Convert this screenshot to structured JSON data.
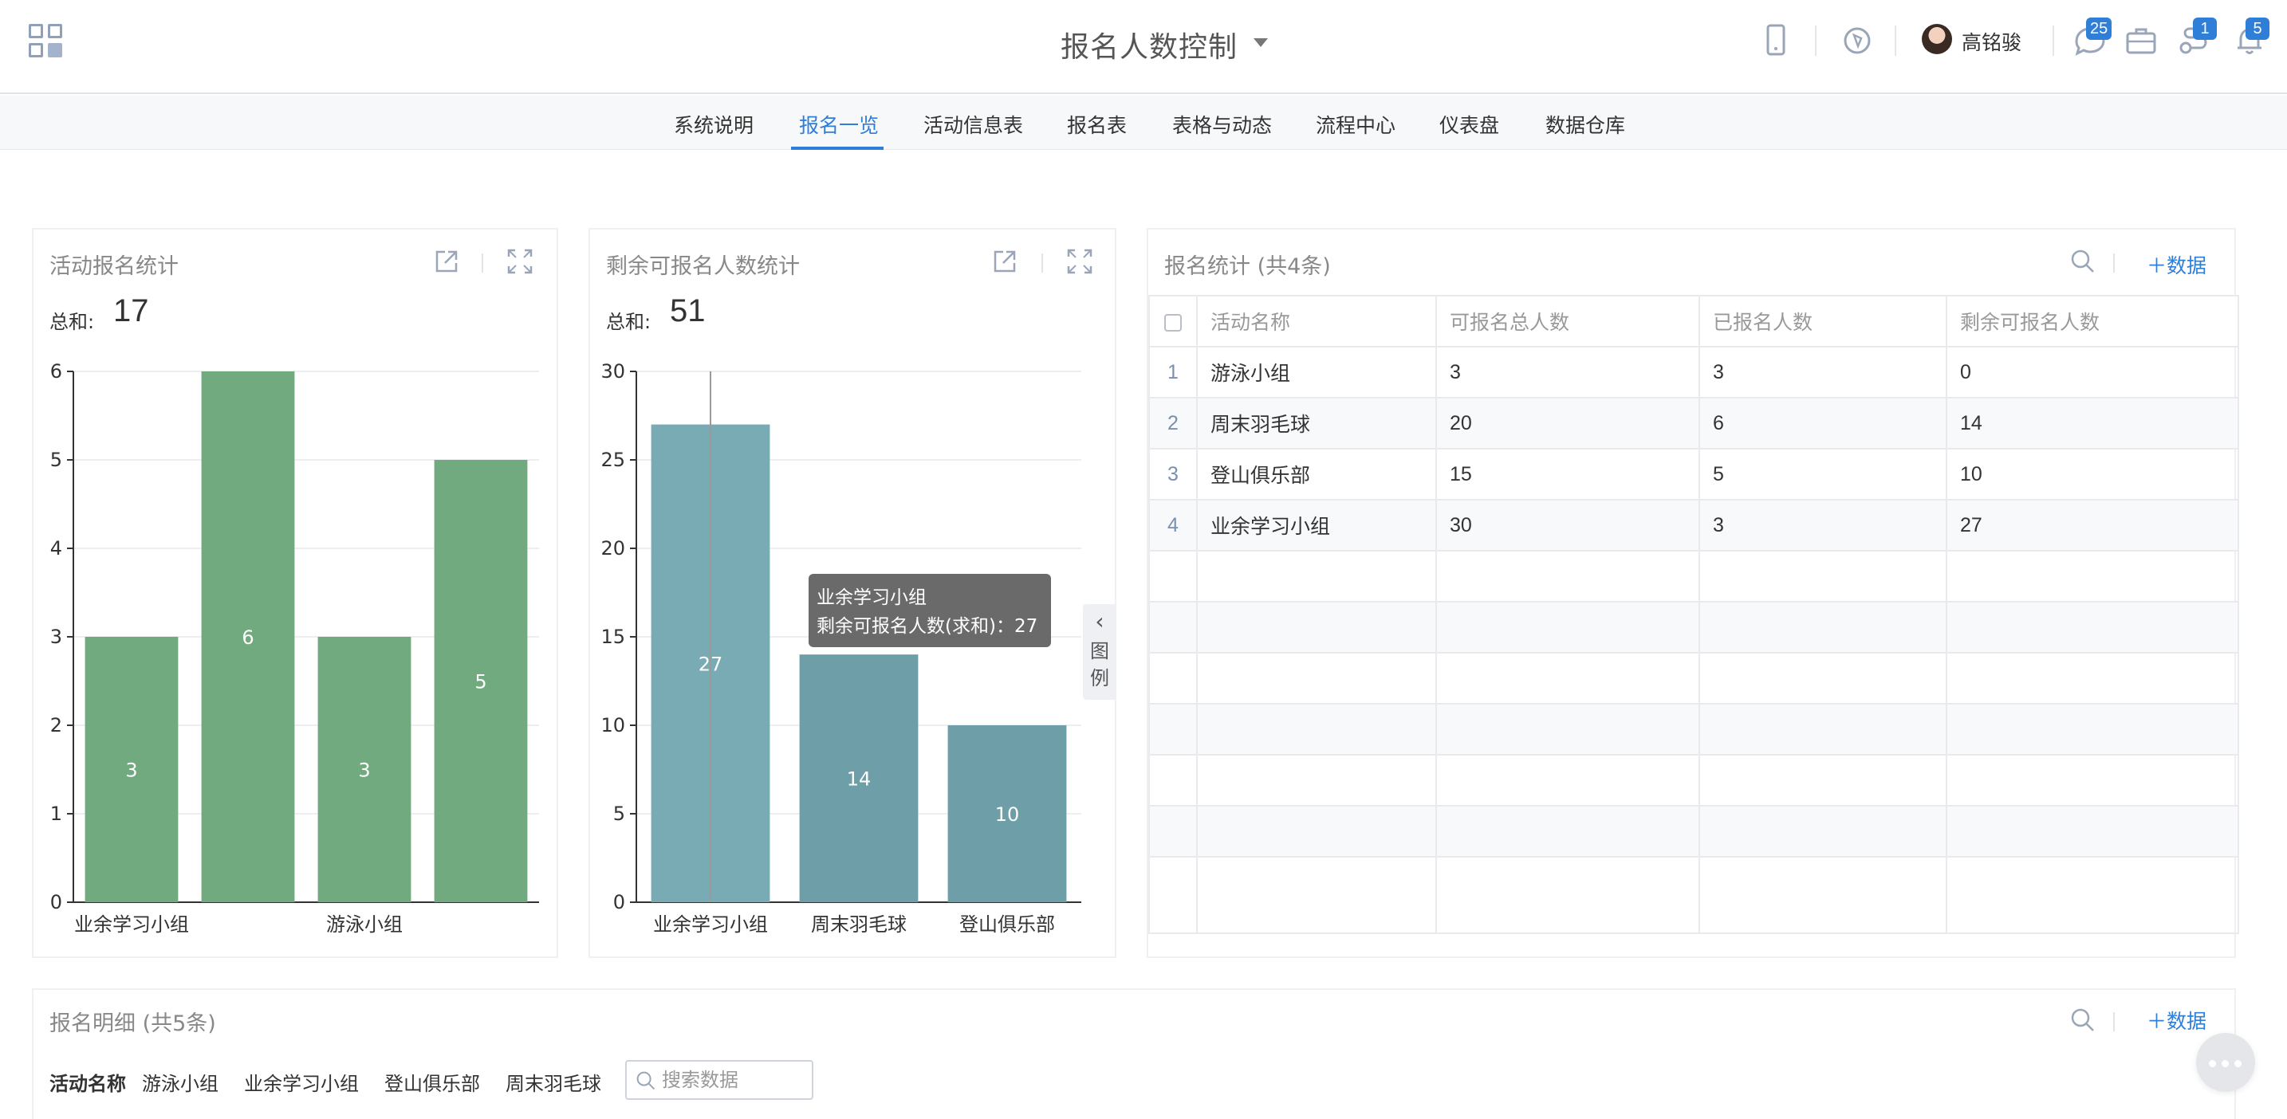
{
  "header": {
    "title": "报名人数控制",
    "user_name": "高铭骏",
    "badges": {
      "chat": "25",
      "tasks": "1",
      "notifications": "5"
    }
  },
  "nav": {
    "tabs": [
      "系统说明",
      "报名一览",
      "活动信息表",
      "报名表",
      "表格与动态",
      "流程中心",
      "仪表盘",
      "数据仓库"
    ],
    "active_index": 1
  },
  "card1": {
    "title": "活动报名统计",
    "sum_label": "总和:",
    "sum_value": "17"
  },
  "card2": {
    "title": "剩余可报名人数统计",
    "sum_label": "总和:",
    "sum_value": "51"
  },
  "chart_data": [
    {
      "type": "bar",
      "categories": [
        "业余学习小组",
        "",
        "游泳小组",
        ""
      ],
      "values": [
        3,
        6,
        3,
        5
      ],
      "ylim": [
        0,
        6
      ],
      "yticks": [
        0,
        1,
        2,
        3,
        4,
        5,
        6
      ],
      "color": "#72aa80",
      "grid": true
    },
    {
      "type": "bar",
      "categories": [
        "业余学习小组",
        "周末羽毛球",
        "登山俱乐部"
      ],
      "values": [
        27,
        14,
        10
      ],
      "ylim": [
        0,
        30
      ],
      "yticks": [
        0,
        5,
        10,
        15,
        20,
        25,
        30
      ],
      "color": "#6e9fa8",
      "highlight_color": "#79abb5",
      "highlight_index": 0,
      "grid": true
    }
  ],
  "tooltip": {
    "line1": "业余学习小组",
    "line2": "剩余可报名人数(求和)：27"
  },
  "legend_toggle": {
    "chevron": "‹",
    "label": "图例"
  },
  "table_card": {
    "title": "报名统计 (共4条)",
    "add_label": "数据",
    "columns": [
      "活动名称",
      "可报名总人数",
      "已报名人数",
      "剩余可报名人数"
    ],
    "rows": [
      [
        "1",
        "游泳小组",
        "3",
        "3",
        "0"
      ],
      [
        "2",
        "周末羽毛球",
        "20",
        "6",
        "14"
      ],
      [
        "3",
        "登山俱乐部",
        "15",
        "5",
        "10"
      ],
      [
        "4",
        "业余学习小组",
        "30",
        "3",
        "27"
      ]
    ]
  },
  "detail_card": {
    "title": "报名明细 (共5条)",
    "add_label": "数据",
    "filter_label": "活动名称",
    "filters": [
      "游泳小组",
      "业余学习小组",
      "登山俱乐部",
      "周末羽毛球"
    ],
    "search_placeholder": "搜索数据"
  },
  "colors": {
    "accent": "#2f7ed8",
    "bar_green": "#72aa80",
    "bar_teal": "#6e9fa8"
  }
}
